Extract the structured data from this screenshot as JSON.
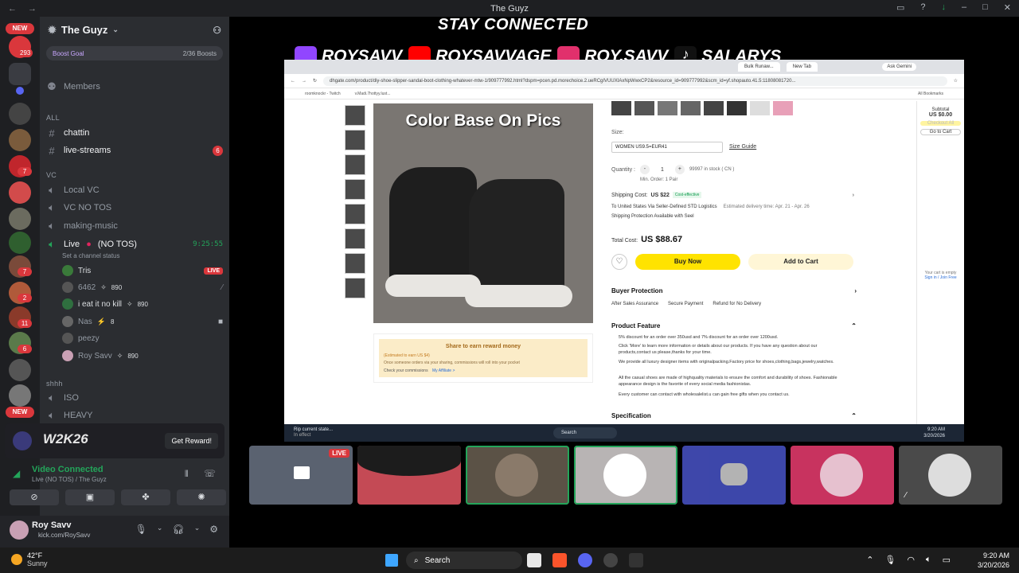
{
  "window": {
    "title": "The Guyz"
  },
  "rail": {
    "new_label": "NEW",
    "badge_293": "293",
    "new_bottom": "NEW",
    "badges": [
      "7",
      "7",
      "2",
      "11",
      "6"
    ]
  },
  "server": {
    "name": "The Guyz",
    "boost_goal": "Boost Goal",
    "boosts": "2/36 Boosts"
  },
  "channels": {
    "members": "Members",
    "all": "ALL",
    "chattin": "chattin",
    "live_streams": "live-streams",
    "live_streams_badge": "6",
    "vc_cat": "VC",
    "local_vc": "Local VC",
    "vc_no_tos": "VC NO TOS",
    "making_music": "making-music",
    "live_channel": "Live",
    "live_channel_suffix": "(NO TOS)",
    "live_time": "9:25:55",
    "set_status": "Set a channel status",
    "shhh_cat": "shhh",
    "iso": "ISO",
    "heavy": "HEAVY"
  },
  "members_in_vc": [
    {
      "name": "Tris",
      "tag": "",
      "live": "LIVE"
    },
    {
      "name": "6462",
      "tag": "890",
      "live": ""
    },
    {
      "name": "i eat it no kill",
      "tag": "890",
      "live": ""
    },
    {
      "name": "Nas",
      "tag": "8",
      "live": ""
    },
    {
      "name": "peezy",
      "tag": "",
      "live": ""
    },
    {
      "name": "Roy Savv",
      "tag": "890",
      "live": ""
    }
  ],
  "promo": {
    "logo": "W2K26",
    "button": "Get Reward!"
  },
  "voice": {
    "status": "Video Connected",
    "channel": "Live (NO TOS) / The Guyz"
  },
  "user": {
    "name": "Roy Savv",
    "status": "kick.com/RoySavv"
  },
  "stream": {
    "banner": "STAY CONNECTED",
    "socials": [
      {
        "handle": "ROYSAVV",
        "color": "#9146ff"
      },
      {
        "handle": "ROYSAVVAGE",
        "color": "#ff0000"
      },
      {
        "handle": "ROY.SAVV",
        "color": "#e1306c"
      },
      {
        "handle": "SALARYS",
        "color": "#111111"
      }
    ]
  },
  "browser": {
    "tabs": [
      "Bulk Runaw...",
      "New Tab"
    ],
    "ask_gemini": "Ask Gemini",
    "url": "dhgate.com/product/diy-shoe-slipper-sandal-boot-clothing-whatever-mtw-1/909777992.html?dspm=pcen.pd.morechoice.2.ueRCgIVUUXIAxNpWwxCP2&resource_id=909777992&scm_id=yf.shopauto.41.5:11808081720...",
    "bookmarks": [
      "roomknockr - Twitch",
      "v.Madi.7hottyy.lust...",
      "All Bookmarks"
    ]
  },
  "product": {
    "image_caption": "Color Base On Pics",
    "size_label": "Size:",
    "size_value": "WOMEN US9.5=EUR41",
    "size_guide": "Size Guide",
    "qty_label": "Quantity :",
    "qty_value": "1",
    "stock": "99997 in stock ( CN )",
    "min_order": "Min. Order: 1 Pair",
    "shipping_label": "Shipping Cost:",
    "shipping_cost": "US $22",
    "cost_effective": "Cost-effective",
    "ship_to": "To United States  Via Seller-Defined STD Logistics",
    "est": "Estimated delivery time: Apr. 21 - Apr. 26",
    "protection": "Shipping Protection Available with Seel",
    "total_label": "Total Cost:",
    "total_value": "US $88.67",
    "buy_now": "Buy Now",
    "add_to_cart": "Add to Cart",
    "buyer_protection": "Buyer Protection",
    "bp_items": [
      "After Sales Assurance",
      "Secure Payment",
      "Refund for No Delivery"
    ],
    "feature_title": "Product Feature",
    "features": [
      "5% discount for an order over 350usd and 7% discount for an order over 1200usd.",
      "Click 'More' to learn more information or details about our products. If you have any question about our products,contact us please,thanks for your time.",
      "We provide all luxury designer items with originalpacking.Factory price for shoes,clothing,bags,jewelry,watches.",
      "All the casual shoes are made of highquality materials to ensure the comfort and durability of shoes. Fashionable appearance design is the favorite of every social media fashionistas.",
      "Every customer can contact with wholesalelist.u can gain free gifts when you contact us."
    ],
    "spec_title": "Specification",
    "share_title": "Share to earn reward money",
    "share_est": "(Estimated to earn US $4)",
    "share_desc": "Once someone orders via your sharing, commissions will roll into your pocket",
    "share_check": "Check your commissions",
    "share_link": "My Affiliate >"
  },
  "cart": {
    "subtotal": "Subtotal",
    "amount": "US $0.00",
    "checkout": "Checkout All",
    "go": "Go to Cart",
    "empty": "Your cart is empty",
    "signin": "Sign in / Join Free"
  },
  "inner_taskbar": {
    "notif": "Rip current state...",
    "notif2": "In effect",
    "search": "Search",
    "time": "9:20 AM",
    "date": "3/20/2026"
  },
  "tiles_live": "LIVE",
  "taskbar": {
    "temp": "42°F",
    "weather": "Sunny",
    "search": "Search",
    "time": "9:20 AM",
    "date": "3/20/2026"
  }
}
